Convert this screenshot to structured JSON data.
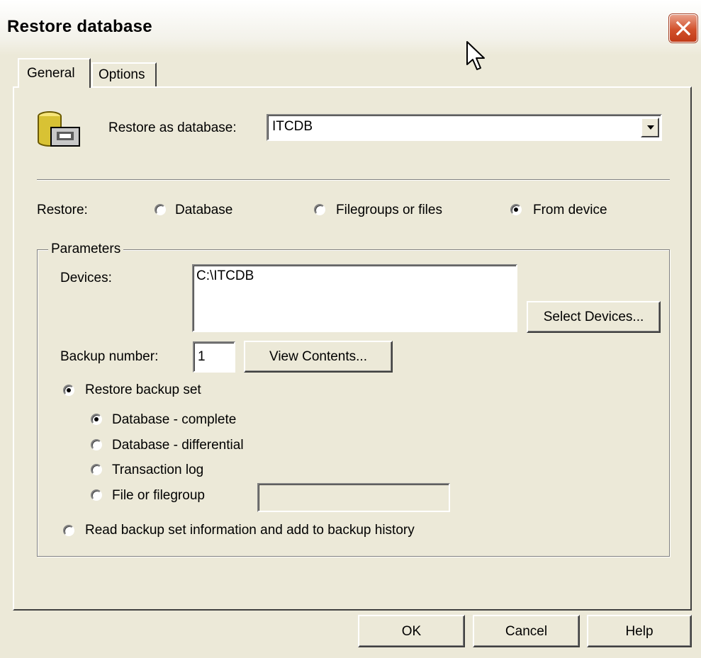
{
  "window": {
    "title": "Restore database"
  },
  "tabs": [
    {
      "label": "General"
    },
    {
      "label": "Options"
    }
  ],
  "restore_as": {
    "label": "Restore as database:",
    "value": "ITCDB"
  },
  "restore_mode": {
    "label": "Restore:",
    "options": [
      "Database",
      "Filegroups or files",
      "From device"
    ],
    "selected": "From device"
  },
  "parameters": {
    "group_label": "Parameters",
    "devices_label": "Devices:",
    "devices": [
      "C:\\ITCDB"
    ],
    "select_devices_label": "Select Devices...",
    "backup_number_label": "Backup number:",
    "backup_number": "1",
    "view_contents_label": "View Contents...",
    "restore_backup_set_label": "Restore backup set",
    "backup_types": [
      "Database - complete",
      "Database - differential",
      "Transaction log",
      "File or filegroup"
    ],
    "selected_backup_type": "Database - complete",
    "read_backup_label": "Read backup set information and add to backup history"
  },
  "buttons": {
    "ok": "OK",
    "cancel": "Cancel",
    "help": "Help"
  }
}
